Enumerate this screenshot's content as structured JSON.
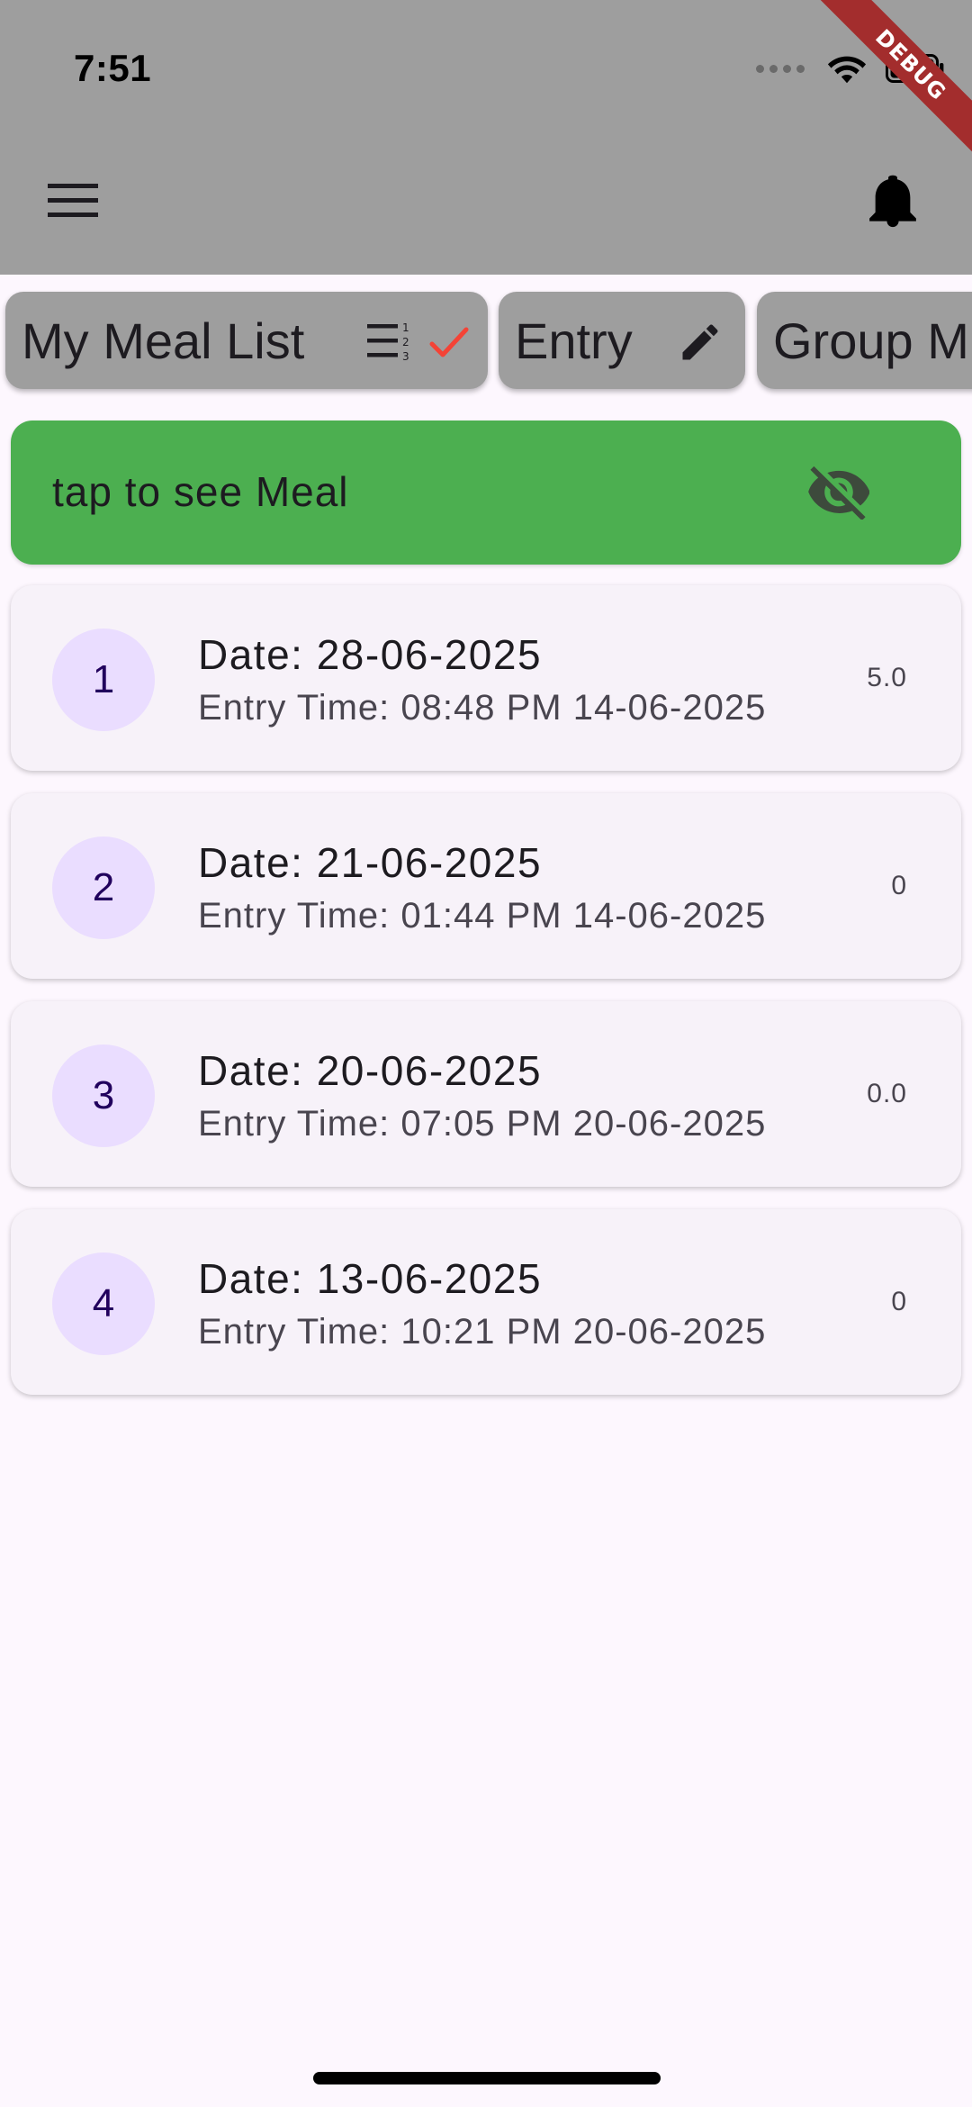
{
  "status_bar": {
    "time": "7:51",
    "debug_banner": "DEBUG"
  },
  "app_bar": {
    "menu_icon": "menu-icon",
    "notification_icon": "bell-icon"
  },
  "tabs": [
    {
      "label": "My Meal List",
      "icon": "checklist-icon",
      "accent": "#f44336"
    },
    {
      "label": "Entry",
      "icon": "edit-icon"
    },
    {
      "label": "Group M",
      "icon": ""
    }
  ],
  "banner": {
    "text": "tap to see Meal",
    "icon": "visibility-off-icon",
    "color": "#4caf50"
  },
  "meals": [
    {
      "index": "1",
      "date": "Date: 28-06-2025",
      "entry_time": "Entry Time: 08:48 PM 14-06-2025",
      "value": "5.0"
    },
    {
      "index": "2",
      "date": "Date: 21-06-2025",
      "entry_time": "Entry Time: 01:44 PM 14-06-2025",
      "value": "0"
    },
    {
      "index": "3",
      "date": "Date: 20-06-2025",
      "entry_time": "Entry Time: 07:05 PM 20-06-2025",
      "value": "0.0"
    },
    {
      "index": "4",
      "date": "Date: 13-06-2025",
      "entry_time": "Entry Time: 10:21 PM 20-06-2025",
      "value": "0"
    }
  ],
  "colors": {
    "app_bar": "#9e9e9e",
    "background": "#fdf7fe",
    "card": "#f7f2f9",
    "avatar": "#eaddff"
  }
}
